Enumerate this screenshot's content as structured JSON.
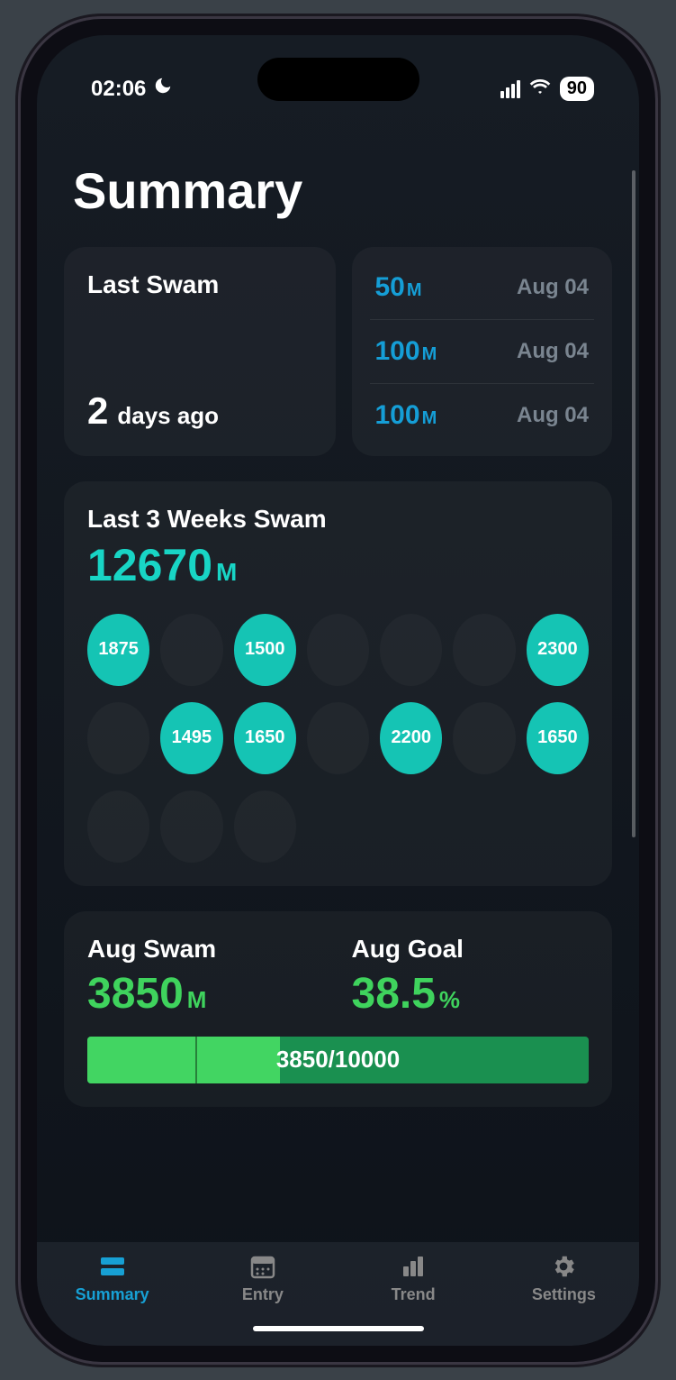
{
  "status": {
    "time": "02:06",
    "battery": "90"
  },
  "page": {
    "title": "Summary"
  },
  "lastSwam": {
    "label": "Last Swam",
    "count": "2",
    "unit": "days ago"
  },
  "recent": [
    {
      "dist": "50",
      "unit": "M",
      "date": "Aug 04"
    },
    {
      "dist": "100",
      "unit": "M",
      "date": "Aug 04"
    },
    {
      "dist": "100",
      "unit": "M",
      "date": "Aug 04"
    }
  ],
  "weeks": {
    "label": "Last 3 Weeks Swam",
    "total": "12670",
    "unit": "M",
    "grid": [
      [
        "1875",
        "",
        "1500",
        "",
        "",
        "",
        "2300"
      ],
      [
        "",
        "1495",
        "1650",
        "",
        "2200",
        "",
        "1650"
      ],
      [
        "",
        "",
        "",
        null,
        null,
        null,
        null
      ]
    ]
  },
  "month": {
    "swamLabel": "Aug Swam",
    "swamValue": "3850",
    "swamUnit": "M",
    "goalLabel": "Aug Goal",
    "goalValue": "38.5",
    "goalUnit": "%",
    "progressText": "3850/10000",
    "progressPct": 38.5,
    "tickPct": 21.5
  },
  "tabs": [
    {
      "label": "Summary",
      "icon": "summary-icon",
      "active": true
    },
    {
      "label": "Entry",
      "icon": "calendar-icon",
      "active": false
    },
    {
      "label": "Trend",
      "icon": "bars-icon",
      "active": false
    },
    {
      "label": "Settings",
      "icon": "gear-icon",
      "active": false
    }
  ]
}
